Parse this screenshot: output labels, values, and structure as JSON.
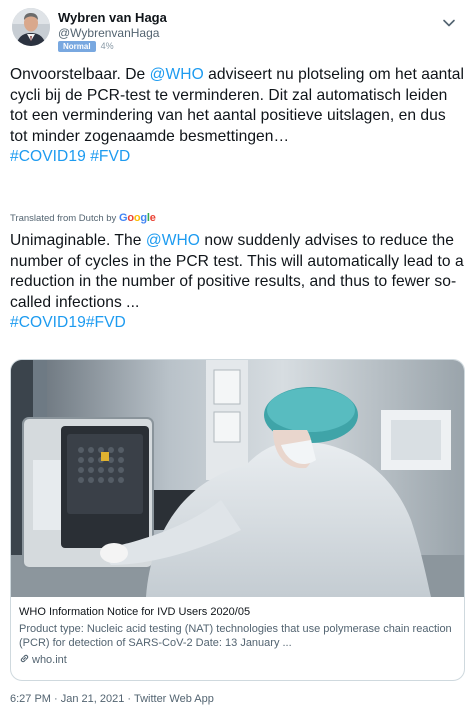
{
  "author": {
    "display_name": "Wybren van Haga",
    "handle": "@WybrenvanHaga",
    "badge": "Normal",
    "badge_percent": "4%"
  },
  "tweet": {
    "original": {
      "part1": "Onvoorstelbaar. De ",
      "mention": "@WHO",
      "part2": " adviseert nu plotseling om het aantal cycli bij de PCR-test te verminderen. Dit zal automatisch leiden tot een vermindering van het aantal positieve uitslagen, en dus tot minder zogenaamde besmettingen…",
      "hashtag1": "#COVID19",
      "hashtag2": "#FVD"
    },
    "translated_from": "Translated from Dutch by",
    "translator_brand": "Google",
    "translation": {
      "part1": "Unimaginable. The ",
      "mention": "@WHO",
      "part2": " now suddenly advises to reduce the number of cycles in the PCR test. This will automatically lead to a reduction in the number of positive results, and thus to fewer so-called infections ...",
      "hashtag1": "#COVID19",
      "hashtag2": "#FVD"
    }
  },
  "card": {
    "title": "WHO Information Notice for IVD Users 2020/05",
    "description": "Product type: Nucleic acid testing (NAT) technologies that use polymerase chain reaction (PCR) for detection of SARS-CoV-2 Date: 13 January ...",
    "domain": "who.int"
  },
  "meta": {
    "time": "6:27 PM",
    "date": "Jan 21, 2021",
    "source": "Twitter Web App",
    "separator": " · "
  },
  "icons": {
    "avatar": "avatar-photo",
    "caret": "chevron-down-icon",
    "link": "link-icon"
  },
  "colors": {
    "link_blue": "#1d9bf0",
    "badge_blue": "#79a8e0",
    "text": "#0f1419",
    "secondary": "#536471",
    "border": "#cfd9de"
  }
}
